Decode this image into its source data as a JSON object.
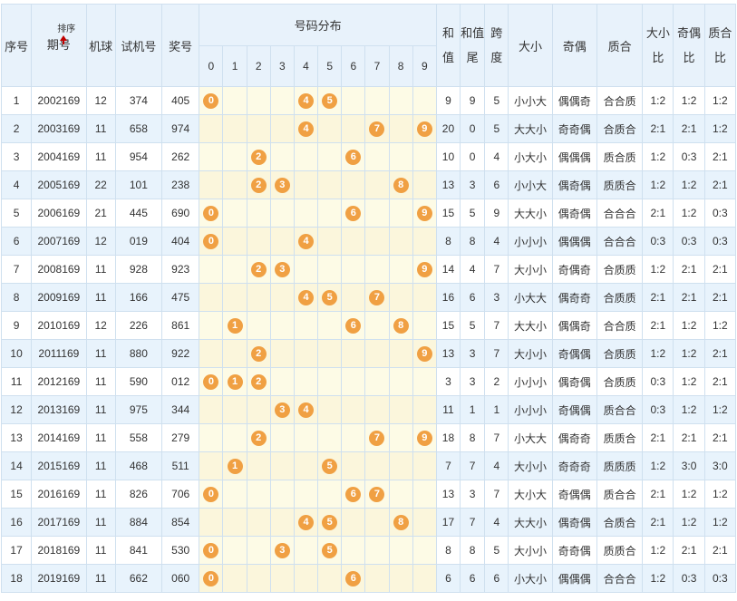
{
  "headers": {
    "seq": "序号",
    "period": "期号",
    "sort": "排序",
    "machine": "机球",
    "test": "试机号",
    "prize": "奖号",
    "dist": "号码分布",
    "digits": [
      "0",
      "1",
      "2",
      "3",
      "4",
      "5",
      "6",
      "7",
      "8",
      "9"
    ],
    "sum": "和值",
    "tail": "和值尾",
    "span": "跨度",
    "size": "大小",
    "parity": "奇偶",
    "prime": "质合",
    "size_ratio": "大小比",
    "parity_ratio": "奇偶比",
    "prime_ratio": "质合比"
  },
  "colors": {
    "ball": "#f0a043",
    "header_bg": "#e8f2fb",
    "alt_row": "#e8f3fc",
    "dist_bg": "#fdfbe6",
    "sort_arrow": "#c00000"
  },
  "rows": [
    {
      "seq": "1",
      "period": "2002169",
      "machine": "12",
      "test": "374",
      "prize": "405",
      "digits": [
        0,
        4,
        5
      ],
      "sum": "9",
      "tail": "9",
      "span": "5",
      "size": "小小大",
      "parity": "偶偶奇",
      "prime": "合合质",
      "size_ratio": "1:2",
      "parity_ratio": "1:2",
      "prime_ratio": "1:2"
    },
    {
      "seq": "2",
      "period": "2003169",
      "machine": "11",
      "test": "658",
      "prize": "974",
      "digits": [
        4,
        7,
        9
      ],
      "sum": "20",
      "tail": "0",
      "span": "5",
      "size": "大大小",
      "parity": "奇奇偶",
      "prime": "合质合",
      "size_ratio": "2:1",
      "parity_ratio": "2:1",
      "prime_ratio": "1:2"
    },
    {
      "seq": "3",
      "period": "2004169",
      "machine": "11",
      "test": "954",
      "prize": "262",
      "digits": [
        2,
        6
      ],
      "sum": "10",
      "tail": "0",
      "span": "4",
      "size": "小大小",
      "parity": "偶偶偶",
      "prime": "质合质",
      "size_ratio": "1:2",
      "parity_ratio": "0:3",
      "prime_ratio": "2:1"
    },
    {
      "seq": "4",
      "period": "2005169",
      "machine": "22",
      "test": "101",
      "prize": "238",
      "digits": [
        2,
        3,
        8
      ],
      "sum": "13",
      "tail": "3",
      "span": "6",
      "size": "小小大",
      "parity": "偶奇偶",
      "prime": "质质合",
      "size_ratio": "1:2",
      "parity_ratio": "1:2",
      "prime_ratio": "2:1"
    },
    {
      "seq": "5",
      "period": "2006169",
      "machine": "21",
      "test": "445",
      "prize": "690",
      "digits": [
        0,
        6,
        9
      ],
      "sum": "15",
      "tail": "5",
      "span": "9",
      "size": "大大小",
      "parity": "偶奇偶",
      "prime": "合合合",
      "size_ratio": "2:1",
      "parity_ratio": "1:2",
      "prime_ratio": "0:3"
    },
    {
      "seq": "6",
      "period": "2007169",
      "machine": "12",
      "test": "019",
      "prize": "404",
      "digits": [
        0,
        4
      ],
      "sum": "8",
      "tail": "8",
      "span": "4",
      "size": "小小小",
      "parity": "偶偶偶",
      "prime": "合合合",
      "size_ratio": "0:3",
      "parity_ratio": "0:3",
      "prime_ratio": "0:3"
    },
    {
      "seq": "7",
      "period": "2008169",
      "machine": "11",
      "test": "928",
      "prize": "923",
      "digits": [
        2,
        3,
        9
      ],
      "sum": "14",
      "tail": "4",
      "span": "7",
      "size": "大小小",
      "parity": "奇偶奇",
      "prime": "合质质",
      "size_ratio": "1:2",
      "parity_ratio": "2:1",
      "prime_ratio": "2:1"
    },
    {
      "seq": "8",
      "period": "2009169",
      "machine": "11",
      "test": "166",
      "prize": "475",
      "digits": [
        4,
        5,
        7
      ],
      "sum": "16",
      "tail": "6",
      "span": "3",
      "size": "小大大",
      "parity": "偶奇奇",
      "prime": "合质质",
      "size_ratio": "2:1",
      "parity_ratio": "2:1",
      "prime_ratio": "2:1"
    },
    {
      "seq": "9",
      "period": "2010169",
      "machine": "12",
      "test": "226",
      "prize": "861",
      "digits": [
        1,
        6,
        8
      ],
      "sum": "15",
      "tail": "5",
      "span": "7",
      "size": "大大小",
      "parity": "偶偶奇",
      "prime": "合合质",
      "size_ratio": "2:1",
      "parity_ratio": "1:2",
      "prime_ratio": "1:2"
    },
    {
      "seq": "10",
      "period": "2011169",
      "machine": "11",
      "test": "880",
      "prize": "922",
      "digits": [
        2,
        9
      ],
      "sum": "13",
      "tail": "3",
      "span": "7",
      "size": "大小小",
      "parity": "奇偶偶",
      "prime": "合质质",
      "size_ratio": "1:2",
      "parity_ratio": "1:2",
      "prime_ratio": "2:1"
    },
    {
      "seq": "11",
      "period": "2012169",
      "machine": "11",
      "test": "590",
      "prize": "012",
      "digits": [
        0,
        1,
        2
      ],
      "sum": "3",
      "tail": "3",
      "span": "2",
      "size": "小小小",
      "parity": "偶奇偶",
      "prime": "合质质",
      "size_ratio": "0:3",
      "parity_ratio": "1:2",
      "prime_ratio": "2:1"
    },
    {
      "seq": "12",
      "period": "2013169",
      "machine": "11",
      "test": "975",
      "prize": "344",
      "digits": [
        3,
        4
      ],
      "sum": "11",
      "tail": "1",
      "span": "1",
      "size": "小小小",
      "parity": "奇偶偶",
      "prime": "质合合",
      "size_ratio": "0:3",
      "parity_ratio": "1:2",
      "prime_ratio": "1:2"
    },
    {
      "seq": "13",
      "period": "2014169",
      "machine": "11",
      "test": "558",
      "prize": "279",
      "digits": [
        2,
        7,
        9
      ],
      "sum": "18",
      "tail": "8",
      "span": "7",
      "size": "小大大",
      "parity": "偶奇奇",
      "prime": "质质合",
      "size_ratio": "2:1",
      "parity_ratio": "2:1",
      "prime_ratio": "2:1"
    },
    {
      "seq": "14",
      "period": "2015169",
      "machine": "11",
      "test": "468",
      "prize": "511",
      "digits": [
        1,
        5
      ],
      "sum": "7",
      "tail": "7",
      "span": "4",
      "size": "大小小",
      "parity": "奇奇奇",
      "prime": "质质质",
      "size_ratio": "1:2",
      "parity_ratio": "3:0",
      "prime_ratio": "3:0"
    },
    {
      "seq": "15",
      "period": "2016169",
      "machine": "11",
      "test": "826",
      "prize": "706",
      "digits": [
        0,
        6,
        7
      ],
      "sum": "13",
      "tail": "3",
      "span": "7",
      "size": "大小大",
      "parity": "奇偶偶",
      "prime": "质合合",
      "size_ratio": "2:1",
      "parity_ratio": "1:2",
      "prime_ratio": "1:2"
    },
    {
      "seq": "16",
      "period": "2017169",
      "machine": "11",
      "test": "884",
      "prize": "854",
      "digits": [
        4,
        5,
        8
      ],
      "sum": "17",
      "tail": "7",
      "span": "4",
      "size": "大大小",
      "parity": "偶奇偶",
      "prime": "合质合",
      "size_ratio": "2:1",
      "parity_ratio": "1:2",
      "prime_ratio": "1:2"
    },
    {
      "seq": "17",
      "period": "2018169",
      "machine": "11",
      "test": "841",
      "prize": "530",
      "digits": [
        0,
        3,
        5
      ],
      "sum": "8",
      "tail": "8",
      "span": "5",
      "size": "大小小",
      "parity": "奇奇偶",
      "prime": "质质合",
      "size_ratio": "1:2",
      "parity_ratio": "2:1",
      "prime_ratio": "2:1"
    },
    {
      "seq": "18",
      "period": "2019169",
      "machine": "11",
      "test": "662",
      "prize": "060",
      "digits": [
        0,
        6
      ],
      "sum": "6",
      "tail": "6",
      "span": "6",
      "size": "小大小",
      "parity": "偶偶偶",
      "prime": "合合合",
      "size_ratio": "1:2",
      "parity_ratio": "0:3",
      "prime_ratio": "0:3"
    }
  ]
}
